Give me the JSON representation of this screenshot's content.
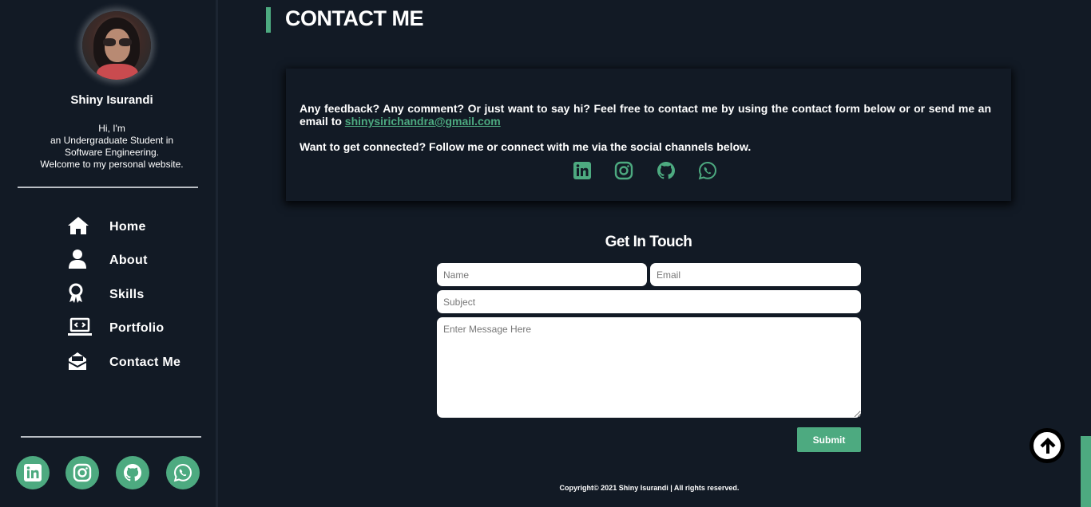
{
  "profile": {
    "name": "Shiny Isurandi",
    "intro_lines": [
      "Hi, I'm",
      "an Undergraduate Student in",
      "Software Engineering.",
      "Welcome to my personal website."
    ]
  },
  "nav": {
    "items": [
      {
        "label": "Home",
        "icon": "home-icon"
      },
      {
        "label": "About",
        "icon": "user-icon"
      },
      {
        "label": "Skills",
        "icon": "award-icon"
      },
      {
        "label": "Portfolio",
        "icon": "laptop-code-icon"
      },
      {
        "label": "Contact Me",
        "icon": "envelope-open-icon"
      }
    ]
  },
  "social": [
    "linkedin-icon",
    "instagram-icon",
    "github-icon",
    "whatsapp-icon"
  ],
  "page": {
    "title": "CONTACT ME"
  },
  "info": {
    "text": "Any feedback? Any comment? Or just want to say hi? Feel free to contact me by using the contact form below or or send me an email to",
    "email": "shinysirichandra@gmail.com",
    "connect_text": "Want to get connected? Follow me or connect with me via the social channels below."
  },
  "form": {
    "title": "Get In Touch",
    "name_placeholder": "Name",
    "email_placeholder": "Email",
    "subject_placeholder": "Subject",
    "message_placeholder": "Enter Message Here",
    "submit_label": "Submit"
  },
  "footer": {
    "text": "Copyright© 2021 Shiny Isurandi | All rights reserved."
  },
  "colors": {
    "background": "#121a25",
    "accent": "#4daa80",
    "text": "#ffffff"
  }
}
